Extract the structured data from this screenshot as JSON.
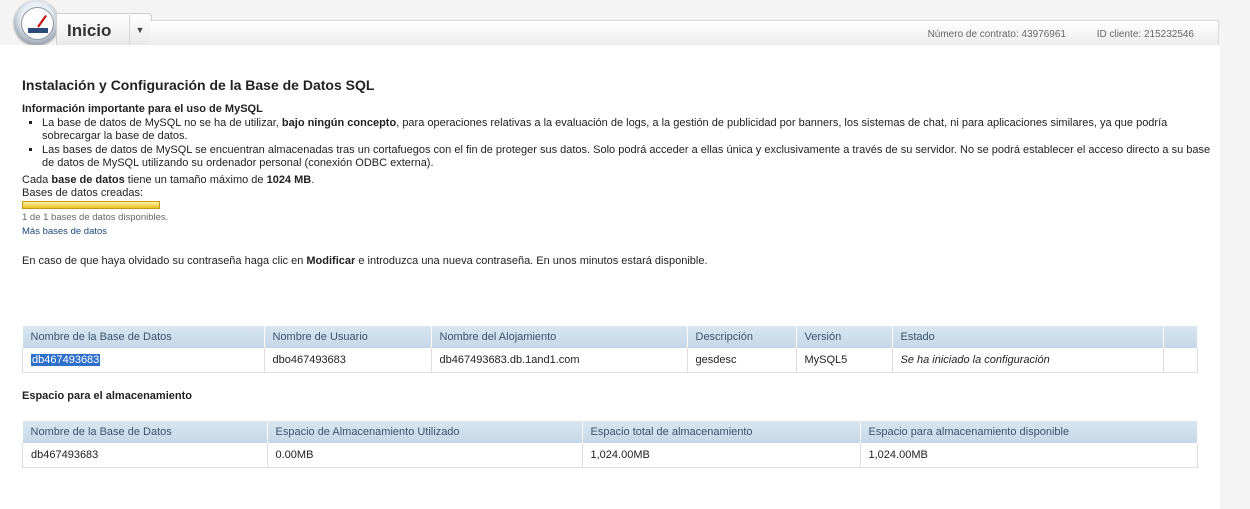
{
  "header": {
    "home_label": "Inicio",
    "dropdown_glyph": "▼",
    "contract": "Número de contrato: 43976961",
    "client_id": "ID cliente: 215232546"
  },
  "main": {
    "title": "Instalación y Configuración de la Base de Datos SQL",
    "info_heading": "Información importante para el uso de MySQL",
    "bullet1": {
      "pre": "La base de datos de MySQL no se ha de utilizar, ",
      "bold": "bajo ningún concepto",
      "post": ", para operaciones relativas a la evaluación de logs, a la gestión de publicidad por banners, los sistemas de chat, ni para aplicaciones similares, ya que podría sobrecargar la base de datos."
    },
    "bullet2": "Las bases de datos de MySQL se encuentran almacenadas tras un cortafuegos con el fin de proteger sus datos. Solo podrá acceder a ellas única y exclusivamente a través de su servidor. No se podrá establecer el acceso directo a su base de datos de MySQL utilizando su ordenador personal (conexión ODBC externa).",
    "max_size": {
      "pre": "Cada ",
      "bold1": "base de datos",
      "mid": " tiene un tamaño máximo de ",
      "bold2": "1024 MB",
      "post": "."
    },
    "created_label": "Bases de datos creadas:",
    "progress_fraction": 1.0,
    "available": "1 de 1 bases de datos disponibles.",
    "more_link": "Más bases de datos",
    "forgot": {
      "pre": "En caso de que haya olvidado su contraseña haga clic en ",
      "bold": "Modificar",
      "post": " e introduzca una nueva contraseña. En unos minutos estará disponible."
    }
  },
  "db_table": {
    "headers": [
      "Nombre de la Base de Datos",
      "Nombre de Usuario",
      "Nombre del Alojamiento",
      "Descripción",
      "Versión",
      "Estado"
    ],
    "row": [
      "db467493683",
      "dbo467493683",
      "db467493683.db.1and1.com",
      "gesdesc",
      "MySQL5",
      "Se ha iniciado la configuración"
    ]
  },
  "storage": {
    "title": "Espacio para el almacenamiento",
    "headers": [
      "Nombre de la Base de Datos",
      "Espacio de Almacenamiento Utilizado",
      "Espacio total de almacenamiento",
      "Espacio para almacenamiento disponible"
    ],
    "row": [
      "db467493683",
      "0.00MB",
      "1,024.00MB",
      "1,024.00MB"
    ]
  }
}
